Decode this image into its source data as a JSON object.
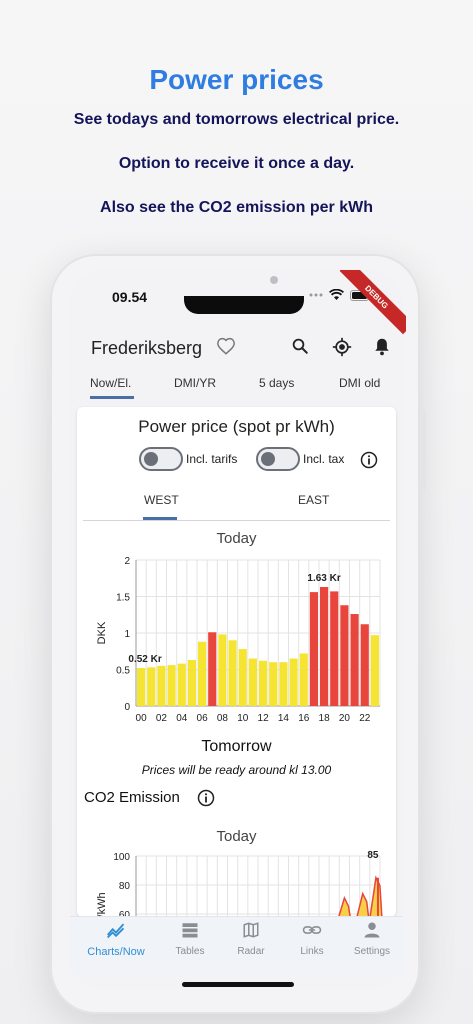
{
  "promo": {
    "title": "Power prices",
    "line1": "See todays and tomorrows electrical price.",
    "line2": "Option to receive it once a day.",
    "line3": "Also see the CO2 emission per kWh"
  },
  "status": {
    "time": "09.54",
    "debug_banner": "DEBUG"
  },
  "appbar": {
    "city": "Frederiksberg"
  },
  "tabs": [
    {
      "label": "Now/El.",
      "active": true
    },
    {
      "label": "DMI/YR",
      "active": false
    },
    {
      "label": "5 days",
      "active": false
    },
    {
      "label": "DMI old",
      "active": false
    }
  ],
  "card": {
    "title": "Power price (spot pr kWh)",
    "toggle_tarifs": "Incl. tarifs",
    "toggle_tax": "Incl. tax",
    "region_west": "WEST",
    "region_east": "EAST",
    "today": "Today",
    "tomorrow": "Tomorrow",
    "tomorrow_note": "Prices will be ready around kl 13.00",
    "co2_title": "CO2 Emission",
    "co2_today": "Today"
  },
  "chart_data": [
    {
      "type": "bar",
      "title": "Today",
      "ylabel": "DKK",
      "ylim": [
        0,
        2
      ],
      "yticks": [
        0,
        0.5,
        1,
        1.5,
        2
      ],
      "xtick_labels": [
        "00",
        "02",
        "04",
        "06",
        "08",
        "10",
        "12",
        "14",
        "16",
        "18",
        "20",
        "22"
      ],
      "categories": [
        "00",
        "01",
        "02",
        "03",
        "04",
        "05",
        "06",
        "07",
        "08",
        "09",
        "10",
        "11",
        "12",
        "13",
        "14",
        "15",
        "16",
        "17",
        "18",
        "19",
        "20",
        "21",
        "22",
        "23"
      ],
      "values": [
        0.52,
        0.53,
        0.55,
        0.56,
        0.58,
        0.63,
        0.88,
        1.01,
        0.98,
        0.9,
        0.78,
        0.65,
        0.62,
        0.6,
        0.6,
        0.65,
        0.72,
        1.56,
        1.63,
        1.57,
        1.38,
        1.26,
        1.12,
        0.97
      ],
      "highlight_indices": [
        7,
        17,
        18,
        19,
        20,
        21,
        22
      ],
      "annotations": [
        {
          "index": 0,
          "label": "0.52 Kr"
        },
        {
          "index": 18,
          "label": "1.63 Kr"
        }
      ],
      "colors": {
        "normal": "#f5e431",
        "high": "#e8453c"
      }
    },
    {
      "type": "area",
      "title": "Today",
      "ylabel": "g/kWh",
      "ylim": [
        60,
        100
      ],
      "yticks": [
        60,
        80,
        100
      ],
      "annotations": [
        {
          "label": "85"
        }
      ],
      "colors": {
        "line": "#e8453c",
        "fill": "#f7d04a"
      }
    }
  ],
  "bottom_nav": [
    {
      "label": "Charts/Now",
      "icon": "chart-line-icon",
      "active": true
    },
    {
      "label": "Tables",
      "icon": "table-icon",
      "active": false
    },
    {
      "label": "Radar",
      "icon": "map-icon",
      "active": false
    },
    {
      "label": "Links",
      "icon": "link-icon",
      "active": false
    },
    {
      "label": "Settings",
      "icon": "person-icon",
      "active": false
    }
  ],
  "colors": {
    "brand": "#2f7de1",
    "navy": "#14145a",
    "tab_indicator": "#4a6fa5",
    "nav_active": "#2f8fd6"
  }
}
